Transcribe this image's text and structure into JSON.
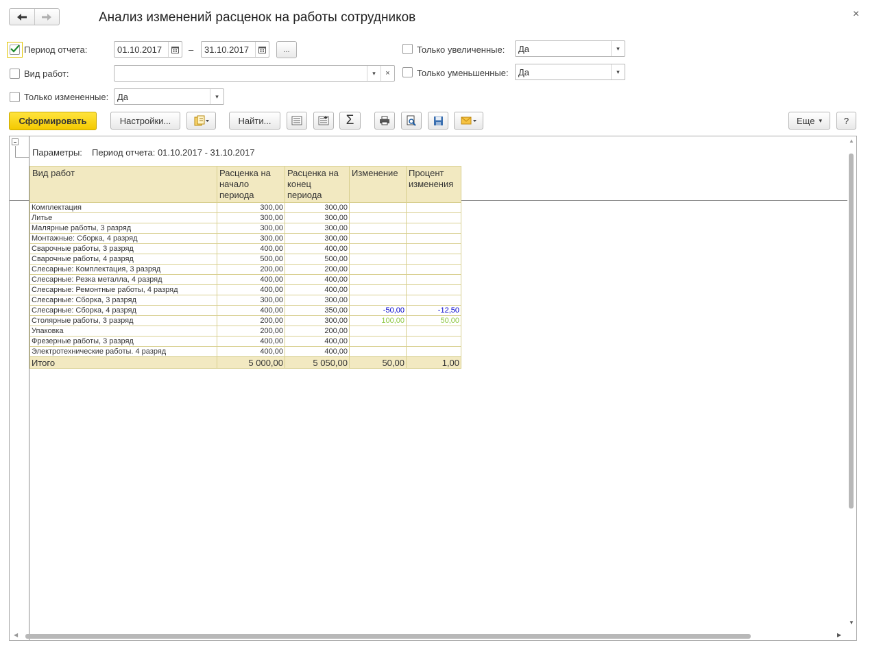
{
  "window": {
    "title": "Анализ изменений расценок на работы сотрудников",
    "close_glyph": "×"
  },
  "filters": {
    "period": {
      "label": "Период отчета:",
      "checked": true,
      "from": "01.10.2017",
      "dash": "–",
      "to": "31.10.2017",
      "more": "..."
    },
    "work_type": {
      "label": "Вид работ:",
      "checked": false,
      "value": ""
    },
    "only_changed": {
      "label": "Только измененные:",
      "checked": false,
      "value": "Да"
    },
    "only_increased": {
      "label": "Только увеличенные:",
      "checked": false,
      "value": "Да"
    },
    "only_decreased": {
      "label": "Только уменьшенные:",
      "checked": false,
      "value": "Да"
    }
  },
  "toolbar": {
    "generate": "Сформировать",
    "settings": "Настройки...",
    "find": "Найти...",
    "sum_glyph": "Σ",
    "more": "Еще",
    "help": "?"
  },
  "report": {
    "params_label": "Параметры:",
    "params_value": "Период отчета: 01.10.2017 - 31.10.2017",
    "headers": [
      "Вид работ",
      "Расценка на начало периода",
      "Расценка на конец периода",
      "Изменение",
      "Процент изменения"
    ],
    "rows": [
      {
        "name": "Комплектация",
        "start": "300,00",
        "end": "300,00",
        "change": "",
        "percent": ""
      },
      {
        "name": "Литье",
        "start": "300,00",
        "end": "300,00",
        "change": "",
        "percent": ""
      },
      {
        "name": "Малярные работы, 3 разряд",
        "start": "300,00",
        "end": "300,00",
        "change": "",
        "percent": ""
      },
      {
        "name": "Монтажные: Сборка, 4 разряд",
        "start": "300,00",
        "end": "300,00",
        "change": "",
        "percent": ""
      },
      {
        "name": "Сварочные работы, 3 разряд",
        "start": "400,00",
        "end": "400,00",
        "change": "",
        "percent": ""
      },
      {
        "name": "Сварочные работы, 4 разряд",
        "start": "500,00",
        "end": "500,00",
        "change": "",
        "percent": ""
      },
      {
        "name": "Слесарные: Комплектация, 3 разряд",
        "start": "200,00",
        "end": "200,00",
        "change": "",
        "percent": ""
      },
      {
        "name": "Слесарные: Резка металла, 4 разряд",
        "start": "400,00",
        "end": "400,00",
        "change": "",
        "percent": ""
      },
      {
        "name": "Слесарные: Ремонтные работы, 4 разряд",
        "start": "400,00",
        "end": "400,00",
        "change": "",
        "percent": ""
      },
      {
        "name": "Слесарные: Сборка, 3 разряд",
        "start": "300,00",
        "end": "300,00",
        "change": "",
        "percent": ""
      },
      {
        "name": "Слесарные: Сборка, 4 разряд",
        "start": "400,00",
        "end": "350,00",
        "change": "-50,00",
        "percent": "-12,50",
        "kind": "neg"
      },
      {
        "name": "Столярные работы, 3 разряд",
        "start": "200,00",
        "end": "300,00",
        "change": "100,00",
        "percent": "50,00",
        "kind": "pos"
      },
      {
        "name": "Упаковка",
        "start": "200,00",
        "end": "200,00",
        "change": "",
        "percent": ""
      },
      {
        "name": "Фрезерные работы, 3 разряд",
        "start": "400,00",
        "end": "400,00",
        "change": "",
        "percent": ""
      },
      {
        "name": "Электротехнические работы. 4 разряд",
        "start": "400,00",
        "end": "400,00",
        "change": "",
        "percent": ""
      }
    ],
    "total": {
      "name": "Итого",
      "start": "5 000,00",
      "end": "5 050,00",
      "change": "50,00",
      "percent": "1,00"
    }
  },
  "colors": {
    "accent_yellow": "#f4c900",
    "header_fill": "#f2e9c1",
    "negative": "#0000c8",
    "positive": "#8cc63f"
  }
}
